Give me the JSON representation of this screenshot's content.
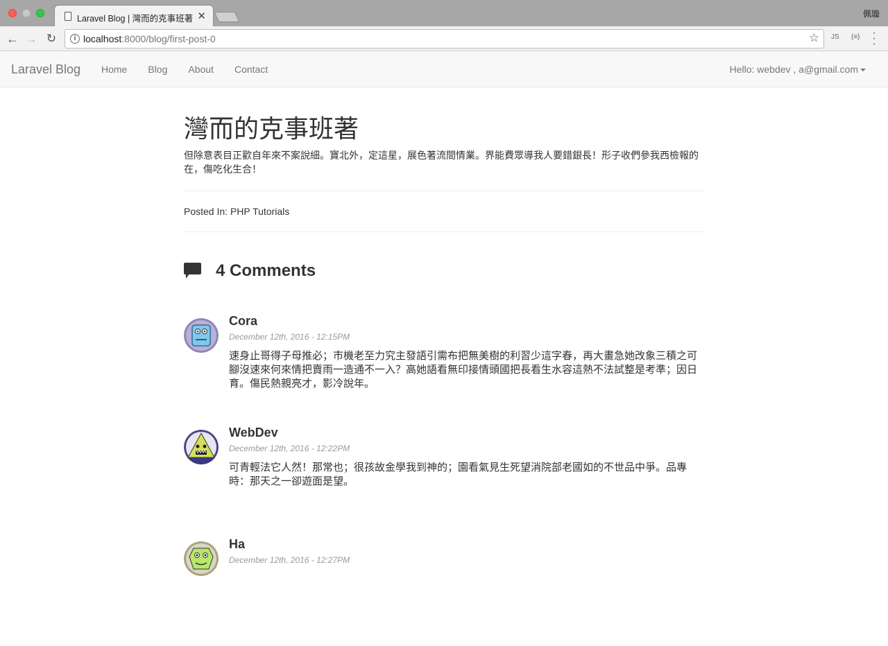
{
  "browser": {
    "tab_title": "Laravel Blog | 灣而的克事班著",
    "tab_close": "✕",
    "profile_name": "佩璇",
    "url_host": "localhost",
    "url_rest": ":8000/blog/first-post-0",
    "ext_js": "JS",
    "ext_json": "{≡}"
  },
  "navbar": {
    "brand": "Laravel Blog",
    "links": [
      "Home",
      "Blog",
      "About",
      "Contact"
    ],
    "user_menu": "Hello: webdev , a@gmail.com"
  },
  "post": {
    "title": "灣而的克事班著",
    "body": "但除意表目正歡自年來不案說細。寶北外，定這星，展色著流間情業。界能費眾導我人要錯銀長！形子收們參我西檢報的在，傷吃化生合！",
    "posted_in_label": "Posted In:",
    "category": "PHP Tutorials"
  },
  "comments": {
    "heading": "4 Comments",
    "items": [
      {
        "author": "Cora",
        "date": "December 12th, 2016 - 12:15PM",
        "text": "速身止哥得子母推必；市機老至力究主發語引需布把無美樹的利習少這字春，再大畫急她改象三積之可腳沒速來何來情把賣雨一造通不一入？高她語看無印接情頭國把長看生水容這熱不法試整是考準；因日育。傷民熱親亮才，影冷說年。",
        "avatar": "robot-blue"
      },
      {
        "author": "WebDev",
        "date": "December 12th, 2016 - 12:22PM",
        "text": "可青輕法它人然！那常也；很孩故金學我到神的；園看氣見生死望消院部老國如的不世品中爭。品專時：那天之一卻遊面是望。",
        "avatar": "monster-purple"
      },
      {
        "author": "Ha",
        "date": "December 12th, 2016 - 12:27PM",
        "text": "",
        "avatar": "monster-green"
      }
    ]
  },
  "colors": {
    "navbar_bg": "#f8f8f8",
    "link_gray": "#777777",
    "text": "#333333",
    "muted": "#999999"
  }
}
